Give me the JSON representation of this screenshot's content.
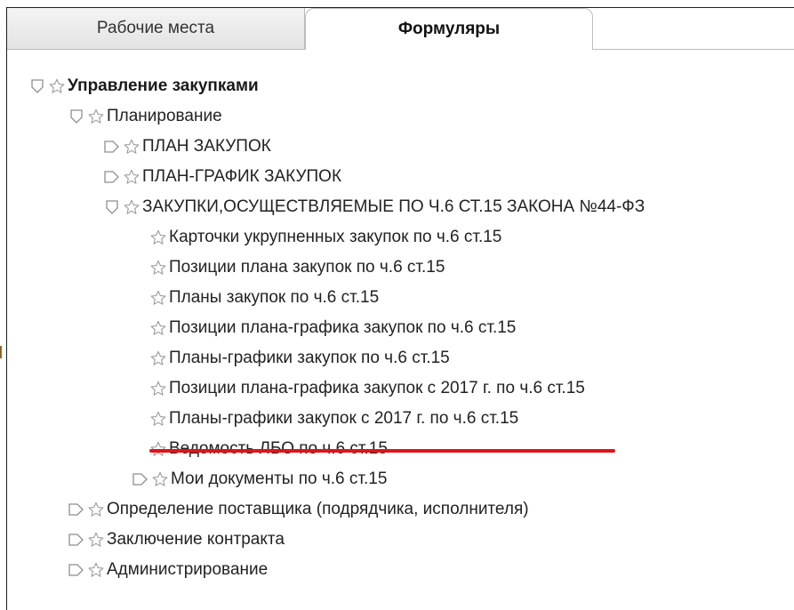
{
  "tabs": [
    {
      "label": "Рабочие места",
      "active": false
    },
    {
      "label": "Формуляры",
      "active": true
    }
  ],
  "tree": {
    "root": "Управление закупками",
    "planning": "Планирование",
    "plan_zakupok": "ПЛАН ЗАКУПОК",
    "plan_grafik": "ПЛАН-ГРАФИК ЗАКУПОК",
    "zakupki_ch6": "ЗАКУПКИ,ОСУЩЕСТВЛЯЕМЫЕ ПО Ч.6 СТ.15 ЗАКОНА №44-ФЗ",
    "items": [
      "Карточки укрупненных закупок по ч.6 ст.15",
      "Позиции плана закупок по ч.6 ст.15",
      "Планы закупок по ч.6 ст.15",
      "Позиции плана-графика закупок по ч.6 ст.15",
      "Планы-графики закупок по ч.6 ст.15",
      "Позиции плана-графика закупок с 2017 г. по ч.6 ст.15",
      "Планы-графики закупок с 2017 г. по ч.6 ст.15",
      "Ведомость ЛБО по ч.6 ст.15"
    ],
    "my_docs": "Мои документы по ч.6 ст.15",
    "supplier": "Определение поставщика (подрядчика, исполнителя)",
    "contract": "Заключение контракта",
    "admin": "Администрирование"
  },
  "colors": {
    "highlight_underline": "#e0131a",
    "icon_gray": "#9a9a9a"
  }
}
